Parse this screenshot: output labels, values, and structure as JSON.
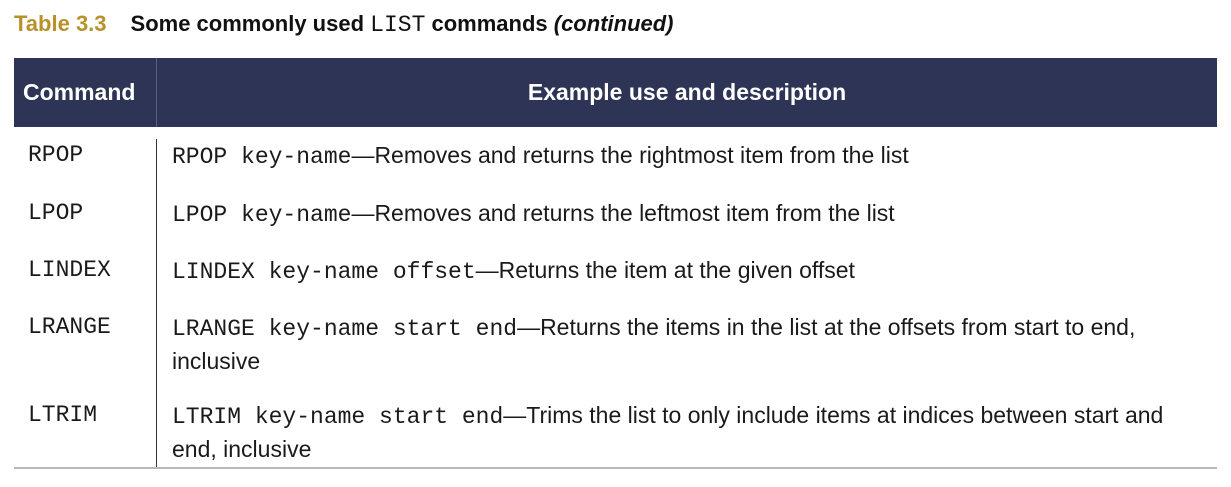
{
  "caption": {
    "label": "Table 3.3",
    "title_prefix": "Some commonly used ",
    "title_code": "LIST",
    "title_suffix": " commands ",
    "title_italic": "(continued)"
  },
  "table": {
    "header": {
      "command": "Command",
      "description": "Example use and description"
    },
    "rows": [
      {
        "command": "RPOP",
        "code": "RPOP key-name",
        "description": "—Removes and returns the rightmost item from the list"
      },
      {
        "command": "LPOP",
        "code": "LPOP key-name",
        "description": "—Removes and returns the leftmost item from the list"
      },
      {
        "command": "LINDEX",
        "code": "LINDEX key-name offset",
        "description": "—Returns the item at the given offset"
      },
      {
        "command": "LRANGE",
        "code": "LRANGE key-name start end",
        "description": "—Returns the items in the list at the offsets from start to end, inclusive"
      },
      {
        "command": "LTRIM",
        "code": "LTRIM key-name start end",
        "description": "—Trims the list to only include items at indices between start and end, inclusive"
      }
    ]
  },
  "colors": {
    "caption_label": "#b8912a",
    "header_background": "#2e3455",
    "header_text": "#ffffff"
  }
}
